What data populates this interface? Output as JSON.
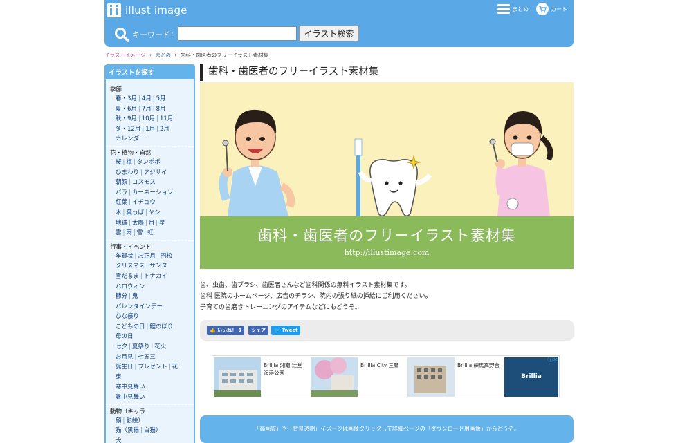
{
  "header": {
    "logo_text": "illust image",
    "menu_label": "まとめ",
    "cart_label": "カート"
  },
  "search": {
    "label": "キーワード：",
    "value": "",
    "button_label": "イラスト検索"
  },
  "breadcrumb": {
    "items": [
      "イラストイメージ",
      "まとめ",
      "歯科・歯医者のフリーイラスト素材集"
    ],
    "separator": "›"
  },
  "sidebar": {
    "heading": "イラストを探す",
    "categories": [
      {
        "title": "季節",
        "lines": [
          [
            "春・3月",
            "4月",
            "5月"
          ],
          [
            "夏・6月",
            "7月",
            "8月"
          ],
          [
            "秋・9月",
            "10月",
            "11月"
          ],
          [
            "冬・12月",
            "1月",
            "2月"
          ],
          [
            "カレンダー"
          ]
        ]
      },
      {
        "title": "花・植物・自然",
        "lines": [
          [
            "桜",
            "梅",
            "タンポポ"
          ],
          [
            "ひまわり",
            "アジサイ"
          ],
          [
            "朝顔",
            "コスモス"
          ],
          [
            "バラ",
            "カーネーション"
          ],
          [
            "紅葉",
            "イチョウ"
          ],
          [
            "木",
            "葉っぱ",
            "ヤシ"
          ],
          [
            "地球",
            "太陽",
            "月",
            "星"
          ],
          [
            "雲",
            "雨",
            "雪",
            "虹"
          ]
        ]
      },
      {
        "title": "行事・イベント",
        "lines": [
          [
            "年賀状",
            "お正月",
            "門松"
          ],
          [
            "クリスマス",
            "サンタ"
          ],
          [
            "雪だるま",
            "トナカイ"
          ],
          [
            "ハロウィン"
          ],
          [
            "節分",
            "鬼"
          ],
          [
            "バレンタインデー"
          ],
          [
            "ひな祭り"
          ],
          [
            "こどもの日",
            "鯉のぼり"
          ],
          [
            "母の日"
          ],
          [
            "七夕",
            "夏祭り",
            "花火"
          ],
          [
            "お月見",
            "七五三"
          ],
          [
            "誕生日",
            "プレゼント",
            "花"
          ],
          [
            "束"
          ],
          [
            "寒中見舞い"
          ],
          [
            "暑中見舞い"
          ]
        ]
      },
      {
        "title": "動物（キャラ",
        "lines": [
          [
            "顔",
            "影絵）"
          ],
          [
            "猫（黒猫",
            "白猫）"
          ],
          [
            "犬"
          ]
        ]
      }
    ]
  },
  "main": {
    "title": "歯科・歯医者のフリーイラスト素材集",
    "hero_title": "歯科・歯医者のフリーイラスト素材集",
    "hero_url": "http://illustimage.com",
    "description": [
      "歯、虫歯、歯ブラシ、歯医者さんなど歯科関係の無料イラスト素材集です。",
      "歯科 医院のホームページ、広告のチラシ、院内の張り紙の挿絵にご利用ください。",
      "子育ての歯磨きトレーニングのアイテムなどにもどうぞ。"
    ],
    "share": {
      "like": "いいね！ 1",
      "share": "シェア",
      "tweet": "Tweet"
    },
    "ad": {
      "tiles": [
        "Brillia 湘南 辻堂 海浜公園",
        "Brillia City 三鷹",
        "Brillia 練馬高野台"
      ],
      "brand": "Brillia"
    },
    "notice": "「高画質」や「背景透明」イメージは画像クリックして詳細ページの「ダウンロード用画像」からどうぞ。"
  },
  "colors": {
    "accent": "#5aa8e6",
    "sidebar": "#64b3ea",
    "hero_bg": "#fbf1bd",
    "hero_band": "#8bba5b"
  }
}
